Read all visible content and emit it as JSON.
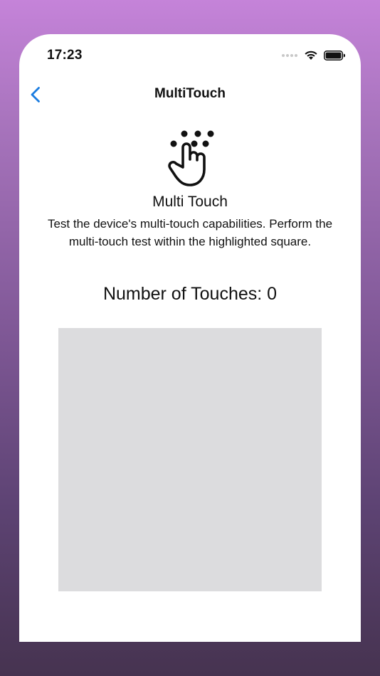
{
  "status_bar": {
    "time": "17:23",
    "icons": [
      "signal-dots-icon",
      "wifi-icon",
      "battery-icon"
    ]
  },
  "nav": {
    "back_icon": "chevron-left-icon",
    "title": "MultiTouch"
  },
  "feature": {
    "icon": "multi-finger-touch-icon",
    "title": "Multi Touch",
    "description": "Test the device's multi-touch capabilities. Perform the multi-touch test within the highlighted square."
  },
  "touch_counter": {
    "text": "Number of Touches: 0"
  },
  "colors": {
    "accent": "#1a7ce0",
    "touch_area": "#dcdcde",
    "text": "#111111"
  }
}
